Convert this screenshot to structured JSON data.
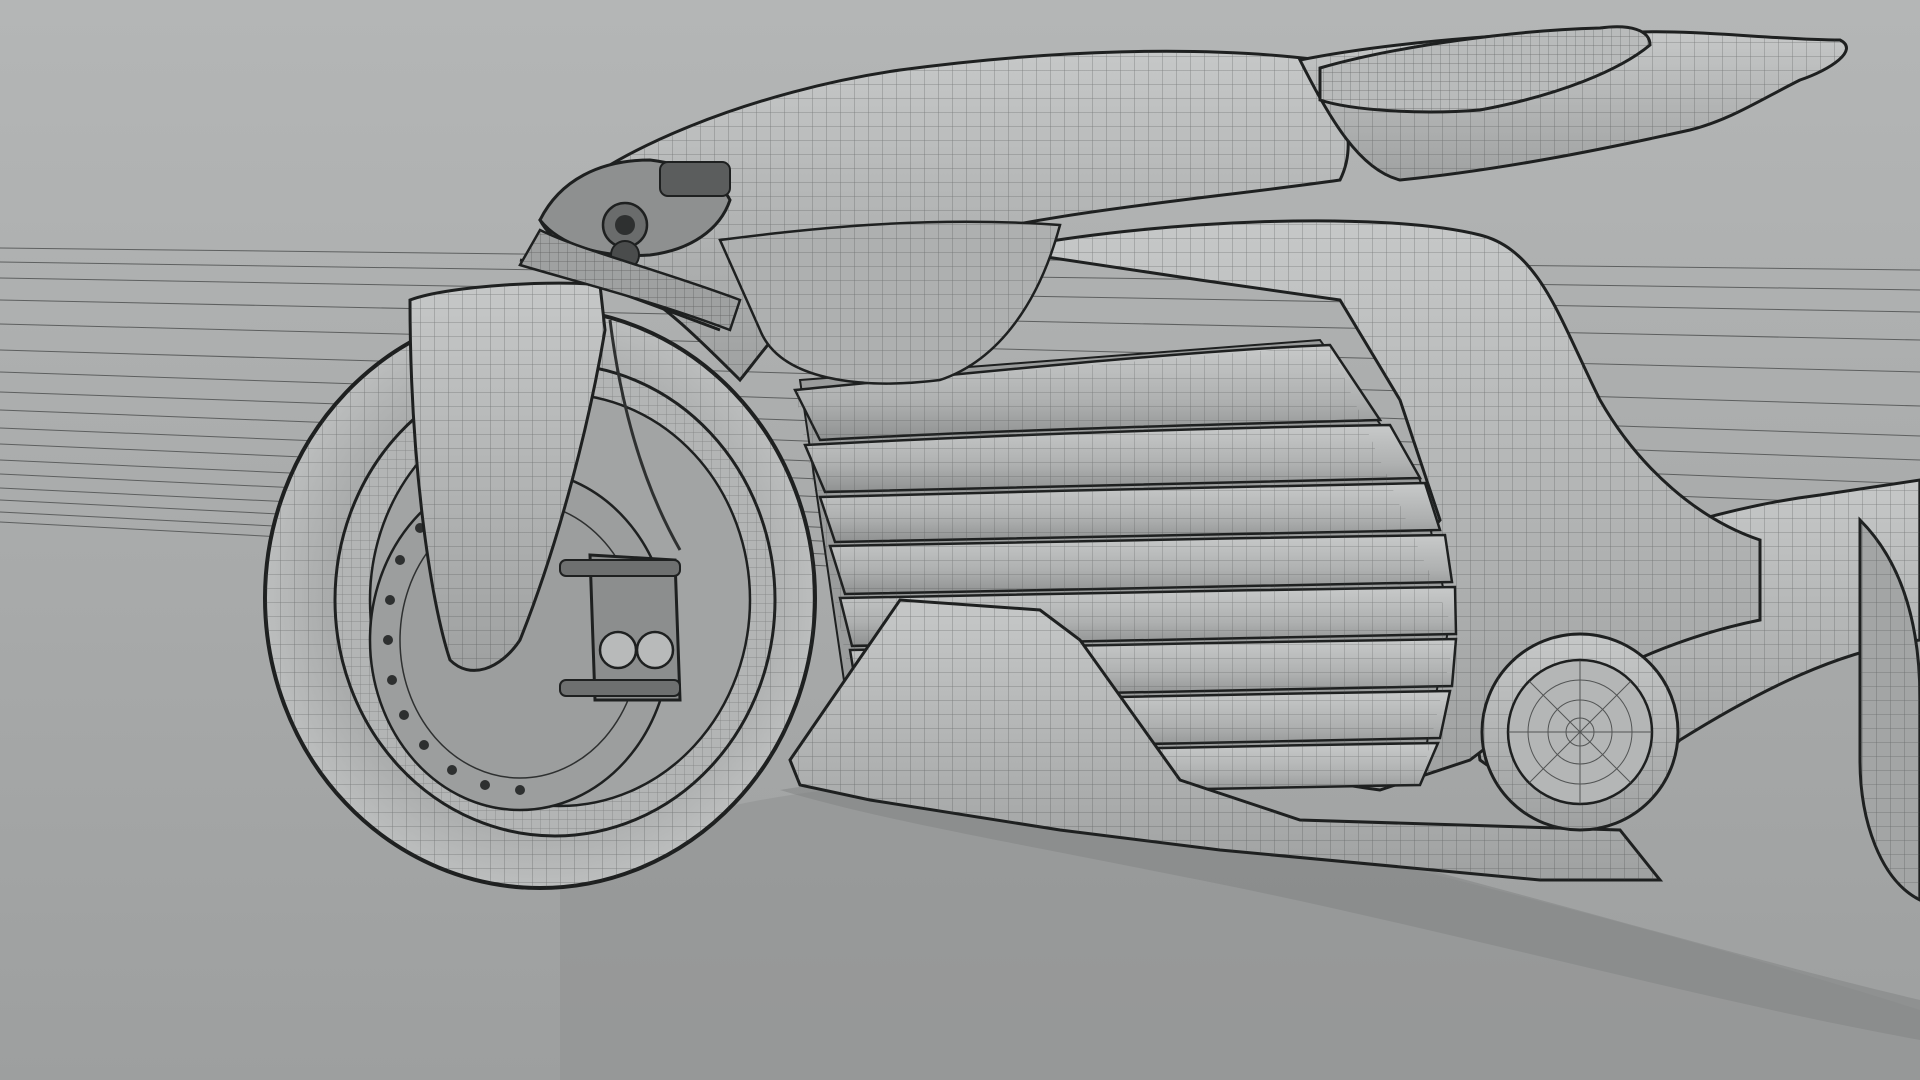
{
  "scene": {
    "subject": "motorcycle-wireframe-render",
    "colors": {
      "background_top": "#aeb0b0",
      "background_bottom": "#9c9e9e",
      "body_fill": "#b9bbbb",
      "body_shade": "#9a9c9c",
      "shadow": "#8c8e8e",
      "wire": "#3a3c3c",
      "tire": "#aeb0b0",
      "outline": "#1e2020"
    }
  }
}
